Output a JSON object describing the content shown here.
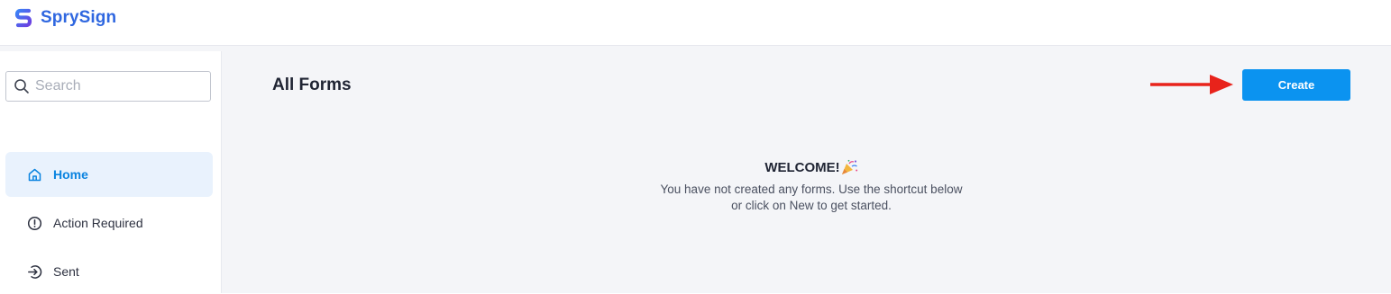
{
  "header": {
    "app_name": "SprySign",
    "logo_icon": "sprysign-logo-icon",
    "brand_color": "#2f67e0"
  },
  "sidebar": {
    "search": {
      "placeholder": "Search",
      "value": ""
    },
    "items": [
      {
        "label": "Home",
        "icon": "home-icon",
        "active": true
      },
      {
        "label": "Action Required",
        "icon": "alert-circle-icon",
        "active": false
      },
      {
        "label": "Sent",
        "icon": "sent-icon",
        "active": false
      }
    ]
  },
  "main": {
    "title": "All Forms",
    "create_label": "Create",
    "accent_color": "#0b93f0",
    "annotation": {
      "icon": "red-arrow-icon",
      "color": "#e8231b"
    },
    "empty_state": {
      "title": "WELCOME!",
      "icon": "party-popper-icon",
      "message": "You have not created any forms. Use the shortcut below or click on New to get started."
    }
  }
}
